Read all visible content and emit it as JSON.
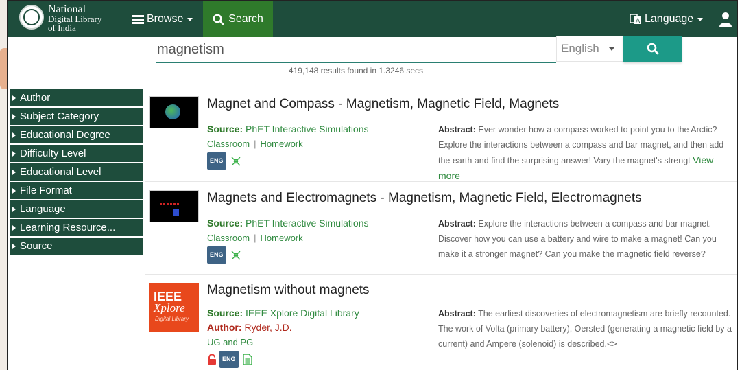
{
  "navbar": {
    "brand_line1": "National",
    "brand_line2": "Digital Library",
    "brand_line3": "of India",
    "browse_label": "Browse",
    "search_label": "Search",
    "language_label": "Language"
  },
  "search": {
    "query": "magnetism",
    "language_selected": "English",
    "results_text": "419,148 results found in 1.3246 secs"
  },
  "sidebar": {
    "items": [
      {
        "label": "Author"
      },
      {
        "label": "Subject Category"
      },
      {
        "label": "Educational Degree"
      },
      {
        "label": "Difficulty Level"
      },
      {
        "label": "Educational Level"
      },
      {
        "label": "File Format"
      },
      {
        "label": "Language"
      },
      {
        "label": "Learning Resource..."
      },
      {
        "label": "Source"
      }
    ]
  },
  "results": [
    {
      "title": "Magnet and Compass - Magnetism, Magnetic Field, Magnets",
      "source_label": "Source:",
      "source": "PhET Interactive Simulations",
      "type1": "Classroom",
      "sep": "|",
      "type2": "Homework",
      "lang_badge": "ENG",
      "abstract_label": "Abstract:",
      "abstract": "Ever wonder how a compass worked to point you to the Arctic? Explore the interactions between a compass and bar magnet, and then add the earth and find the surprising answer! Vary the magnet's strengt",
      "view_more": "View more"
    },
    {
      "title": "Magnets and Electromagnets - Magnetism, Magnetic Field, Electromagnets",
      "source_label": "Source:",
      "source": "PhET Interactive Simulations",
      "type1": "Classroom",
      "sep": "|",
      "type2": "Homework",
      "lang_badge": "ENG",
      "abstract_label": "Abstract:",
      "abstract": "Explore the interactions between a compass and bar magnet. Discover how you can use a battery and wire to make a magnet! Can you make it a stronger magnet? Can you make the magnetic field reverse?"
    },
    {
      "title": "Magnetism without magnets",
      "source_label": "Source:",
      "source": "IEEE Xplore Digital Library",
      "author_label": "Author:",
      "author": "Ryder, J.D.",
      "degree": "UG and PG",
      "lang_badge": "ENG",
      "thumb_line1": "IEEE",
      "thumb_line2": "Xplore",
      "thumb_line3": "Digital Library",
      "abstract_label": "Abstract:",
      "abstract": "The earliest discoveries of electromagnetism are briefly recounted. The work of Volta (primary battery), Oersted (generating a magnetic field by a current) and Ampere (solenoid) is described.<>"
    }
  ],
  "colors": {
    "navbar_bg": "#1e4d3c",
    "search_tab_bg": "#2f7a2b",
    "search_button_bg": "#1c9a88",
    "link_green": "#2f8a3f",
    "author_red": "#b02a1e"
  },
  "icons": [
    "logo-emblem",
    "menu-icon",
    "search-icon",
    "language-icon",
    "user-icon",
    "caret-down-icon",
    "triangle-right-icon",
    "simulation-icon",
    "unlock-icon",
    "document-icon"
  ]
}
